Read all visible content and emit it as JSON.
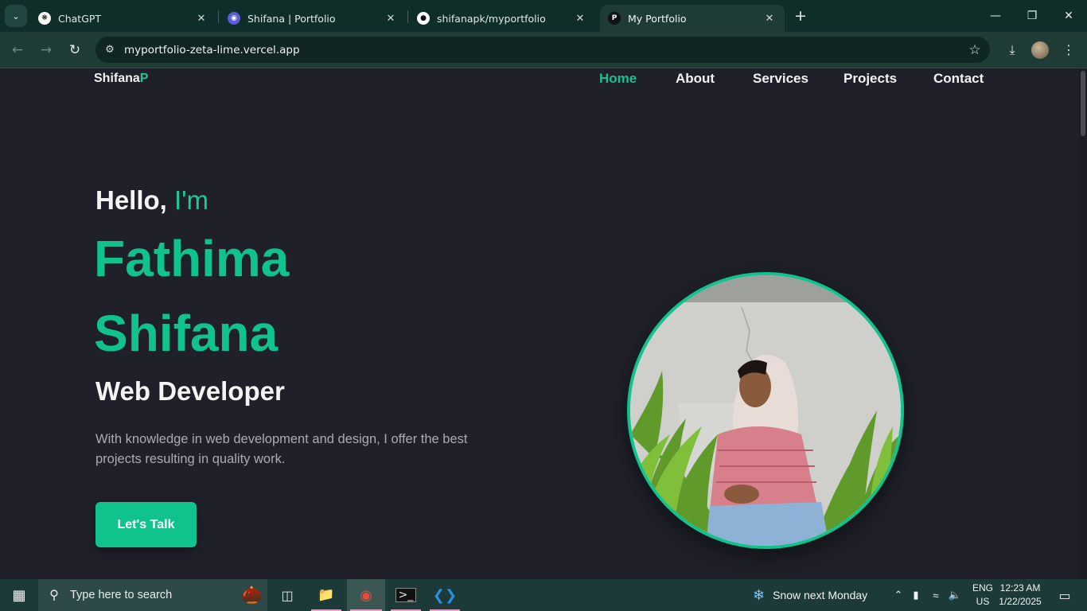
{
  "browser": {
    "tabs": [
      {
        "title": "ChatGPT",
        "icon": "chatgpt-icon"
      },
      {
        "title": "Shifana | Portfolio",
        "icon": "portfolio-icon"
      },
      {
        "title": "shifanapk/myportfolio",
        "icon": "github-icon"
      },
      {
        "title": "My Portfolio",
        "icon": "p-icon",
        "favicon_letter": "P",
        "active": true
      }
    ],
    "url": "myportfolio-zeta-lime.vercel.app"
  },
  "site": {
    "logo": {
      "main": "Shifana",
      "accent": "P"
    },
    "nav": [
      {
        "label": "Home",
        "active": true
      },
      {
        "label": "About"
      },
      {
        "label": "Services"
      },
      {
        "label": "Projects"
      },
      {
        "label": "Contact"
      }
    ],
    "hero": {
      "greeting": "Hello,",
      "greeting_accent": "I'm",
      "name_line1": "Fathima",
      "name_line2": "Shifana",
      "role": "Web Developer",
      "description": "With knowledge in web development and design, I offer the best projects resulting in quality work.",
      "cta_label": "Let's Talk"
    },
    "colors": {
      "accent": "#10c38d",
      "background": "#1f2029"
    }
  },
  "taskbar": {
    "search_placeholder": "Type here to search",
    "weather": "Snow next Monday",
    "lang_line1": "ENG",
    "lang_line2": "US",
    "time": "12:23 AM",
    "date": "1/22/2025"
  }
}
